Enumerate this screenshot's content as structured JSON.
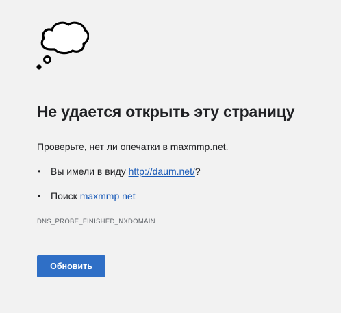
{
  "error": {
    "icon": "sad-cloud-icon",
    "title": "Не удается открыть эту страницу",
    "check_text": "Проверьте, нет ли опечатки в maxmmp.net.",
    "suggestions": {
      "did_you_mean_prefix": "Вы имели в виду ",
      "did_you_mean_link": "http://daum.net/",
      "did_you_mean_suffix": "?",
      "search_prefix": "Поиск ",
      "search_link": "maxmmp net"
    },
    "bullet": "•",
    "code": "DNS_PROBE_FINISHED_NXDOMAIN",
    "reload_label": "Обновить"
  },
  "colors": {
    "background": "#f2f2f2",
    "text": "#202124",
    "link": "#1a5bb8",
    "button": "#2f6fc6",
    "button_text": "#ffffff",
    "error_code": "#5f6368"
  }
}
